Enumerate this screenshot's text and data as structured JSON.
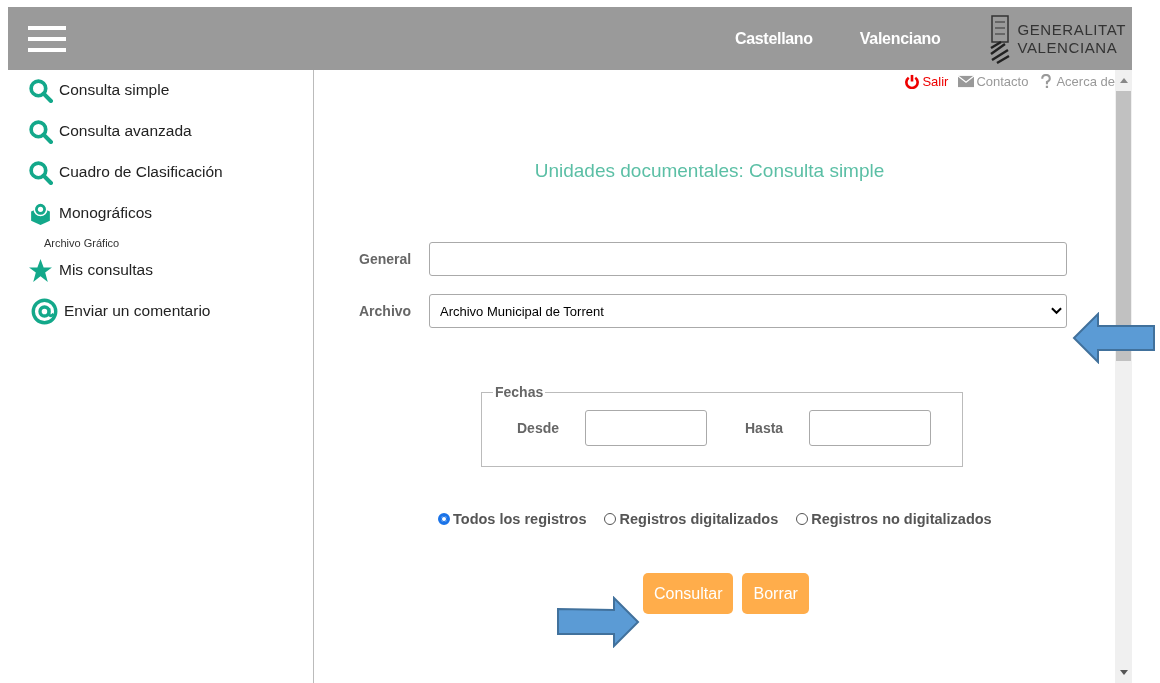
{
  "header": {
    "languages": [
      "Castellano",
      "Valenciano"
    ],
    "logo": [
      "GENERALITAT",
      "VALENCIANA"
    ]
  },
  "sidebar": {
    "items": [
      {
        "kind": "search",
        "label": "Consulta simple"
      },
      {
        "kind": "search",
        "label": "Consulta avanzada"
      },
      {
        "kind": "search",
        "label": "Cuadro de Clasificación"
      },
      {
        "kind": "box",
        "label": "Monográficos"
      },
      {
        "kind": "caption",
        "label": "Archivo Gráfico"
      },
      {
        "kind": "star",
        "label": "Mis consultas"
      },
      {
        "kind": "at",
        "label": "Enviar un comentario"
      }
    ]
  },
  "toplinks": [
    {
      "kind": "power",
      "label": "Salir"
    },
    {
      "kind": "mail",
      "label": "Contacto"
    },
    {
      "kind": "help",
      "label": "Acerca de"
    }
  ],
  "title": "Unidades documentales: Consulta simple",
  "form": {
    "general_label": "General",
    "archivo_label": "Archivo",
    "archivo_value": "Archivo Municipal de Torrent",
    "fechas": {
      "legend": "Fechas",
      "desde": "Desde",
      "hasta": "Hasta"
    },
    "options": [
      {
        "label": "Todos los registros",
        "selected": true
      },
      {
        "label": "Registros digitalizados",
        "selected": false
      },
      {
        "label": "Registros no digitalizados",
        "selected": false
      }
    ],
    "buttons": [
      "Consultar",
      "Borrar"
    ]
  }
}
